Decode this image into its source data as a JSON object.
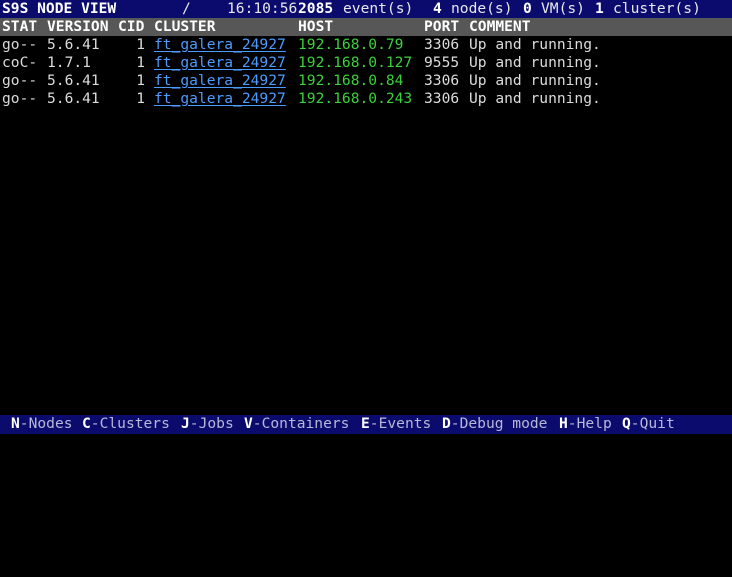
{
  "title_bar": {
    "view_name": "S9S NODE VIEW",
    "spinner": "/",
    "time": "16:10:56",
    "events_count": "2085",
    "events_label": "event(s)",
    "nodes_count": "4",
    "nodes_label": "node(s)",
    "vms_count": "0",
    "vms_label": "VM(s)",
    "clusters_count": "1",
    "clusters_label": "cluster(s)"
  },
  "table": {
    "columns": [
      "STAT",
      "VERSION",
      "CID",
      "CLUSTER",
      "HOST",
      "PORT",
      "COMMENT"
    ],
    "rows": [
      {
        "stat": "go--",
        "version": "5.6.41",
        "cid": "1",
        "cluster": "ft_galera_24927",
        "host": "192.168.0.79",
        "port": "3306",
        "comment": "Up and running."
      },
      {
        "stat": "coC-",
        "version": "1.7.1",
        "cid": "1",
        "cluster": "ft_galera_24927",
        "host": "192.168.0.127",
        "port": "9555",
        "comment": "Up and running."
      },
      {
        "stat": "go--",
        "version": "5.6.41",
        "cid": "1",
        "cluster": "ft_galera_24927",
        "host": "192.168.0.84",
        "port": "3306",
        "comment": "Up and running."
      },
      {
        "stat": "go--",
        "version": "5.6.41",
        "cid": "1",
        "cluster": "ft_galera_24927",
        "host": "192.168.0.243",
        "port": "3306",
        "comment": "Up and running."
      }
    ]
  },
  "footer": {
    "items": [
      {
        "key": "N",
        "label": "-Nodes"
      },
      {
        "key": "C",
        "label": "-Clusters"
      },
      {
        "key": "J",
        "label": "-Jobs"
      },
      {
        "key": "V",
        "label": "-Containers"
      },
      {
        "key": "E",
        "label": "-Events"
      },
      {
        "key": "D",
        "label": "-Debug mode"
      },
      {
        "key": "H",
        "label": "-Help"
      },
      {
        "key": "Q",
        "label": "-Quit"
      }
    ]
  },
  "colors": {
    "bar_background": "#0b0b6e",
    "header_background": "#575757",
    "cluster_link": "#4c9cff",
    "host_text": "#3ad13a",
    "screen_background": "#000000"
  }
}
